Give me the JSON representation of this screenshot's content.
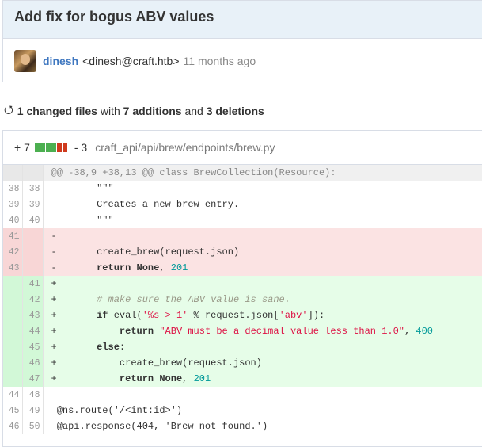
{
  "commit": {
    "title": "Add fix for bogus ABV values",
    "author_name": "dinesh",
    "author_email": "<dinesh@craft.htb>",
    "time": "11 months ago"
  },
  "summary": {
    "icon": "sync-icon",
    "files_count": "1 changed files",
    "with": "with",
    "additions": "7 additions",
    "and": "and",
    "deletions": "3 deletions"
  },
  "file": {
    "adds": "+ 7",
    "dels": "- 3",
    "path": "craft_api/api/brew/endpoints/brew.py",
    "diffbar": [
      "g",
      "g",
      "g",
      "g",
      "r",
      "r"
    ]
  },
  "hunk_header": "@@ -38,9 +38,13 @@ class BrewCollection(Resource):",
  "lines": [
    {
      "type": "ctx",
      "old": "38",
      "new": "38",
      "segs": [
        [
          "plain",
          "        \"\"\""
        ]
      ]
    },
    {
      "type": "ctx",
      "old": "39",
      "new": "39",
      "segs": [
        [
          "plain",
          "        Creates a new brew entry."
        ]
      ]
    },
    {
      "type": "ctx",
      "old": "40",
      "new": "40",
      "segs": [
        [
          "plain",
          "        \"\"\""
        ]
      ]
    },
    {
      "type": "del",
      "old": "41",
      "new": "",
      "segs": [
        [
          "plain",
          "-"
        ]
      ]
    },
    {
      "type": "del",
      "old": "42",
      "new": "",
      "segs": [
        [
          "plain",
          "-       create_brew(request.json)"
        ]
      ]
    },
    {
      "type": "del",
      "old": "43",
      "new": "",
      "segs": [
        [
          "plain",
          "-       "
        ],
        [
          "k",
          "return"
        ],
        [
          "plain",
          " "
        ],
        [
          "k",
          "None"
        ],
        [
          "plain",
          ", "
        ],
        [
          "n",
          "201"
        ]
      ]
    },
    {
      "type": "add",
      "old": "",
      "new": "41",
      "segs": [
        [
          "plain",
          "+"
        ]
      ]
    },
    {
      "type": "add",
      "old": "",
      "new": "42",
      "segs": [
        [
          "plain",
          "+       "
        ],
        [
          "c",
          "# make sure the ABV value is sane."
        ]
      ]
    },
    {
      "type": "add",
      "old": "",
      "new": "43",
      "segs": [
        [
          "plain",
          "+       "
        ],
        [
          "k",
          "if"
        ],
        [
          "plain",
          " eval("
        ],
        [
          "s",
          "'%s > 1'"
        ],
        [
          "plain",
          " % request.json["
        ],
        [
          "s",
          "'abv'"
        ],
        [
          "plain",
          "]):"
        ]
      ]
    },
    {
      "type": "add",
      "old": "",
      "new": "44",
      "segs": [
        [
          "plain",
          "+           "
        ],
        [
          "k",
          "return"
        ],
        [
          "plain",
          " "
        ],
        [
          "s",
          "\"ABV must be a decimal value less than 1.0\""
        ],
        [
          "plain",
          ", "
        ],
        [
          "n",
          "400"
        ]
      ]
    },
    {
      "type": "add",
      "old": "",
      "new": "45",
      "segs": [
        [
          "plain",
          "+       "
        ],
        [
          "k",
          "else"
        ],
        [
          "plain",
          ":"
        ]
      ]
    },
    {
      "type": "add",
      "old": "",
      "new": "46",
      "segs": [
        [
          "plain",
          "+           create_brew(request.json)"
        ]
      ]
    },
    {
      "type": "add",
      "old": "",
      "new": "47",
      "segs": [
        [
          "plain",
          "+           "
        ],
        [
          "k",
          "return"
        ],
        [
          "plain",
          " "
        ],
        [
          "k",
          "None"
        ],
        [
          "plain",
          ", "
        ],
        [
          "n",
          "201"
        ]
      ]
    },
    {
      "type": "ctx",
      "old": "44",
      "new": "48",
      "segs": [
        [
          "plain",
          ""
        ]
      ]
    },
    {
      "type": "ctx",
      "old": "45",
      "new": "49",
      "segs": [
        [
          "plain",
          " @ns.route('/<int:id>')"
        ]
      ]
    },
    {
      "type": "ctx",
      "old": "46",
      "new": "50",
      "segs": [
        [
          "plain",
          " @api.response(404, 'Brew not found.')"
        ]
      ]
    }
  ]
}
